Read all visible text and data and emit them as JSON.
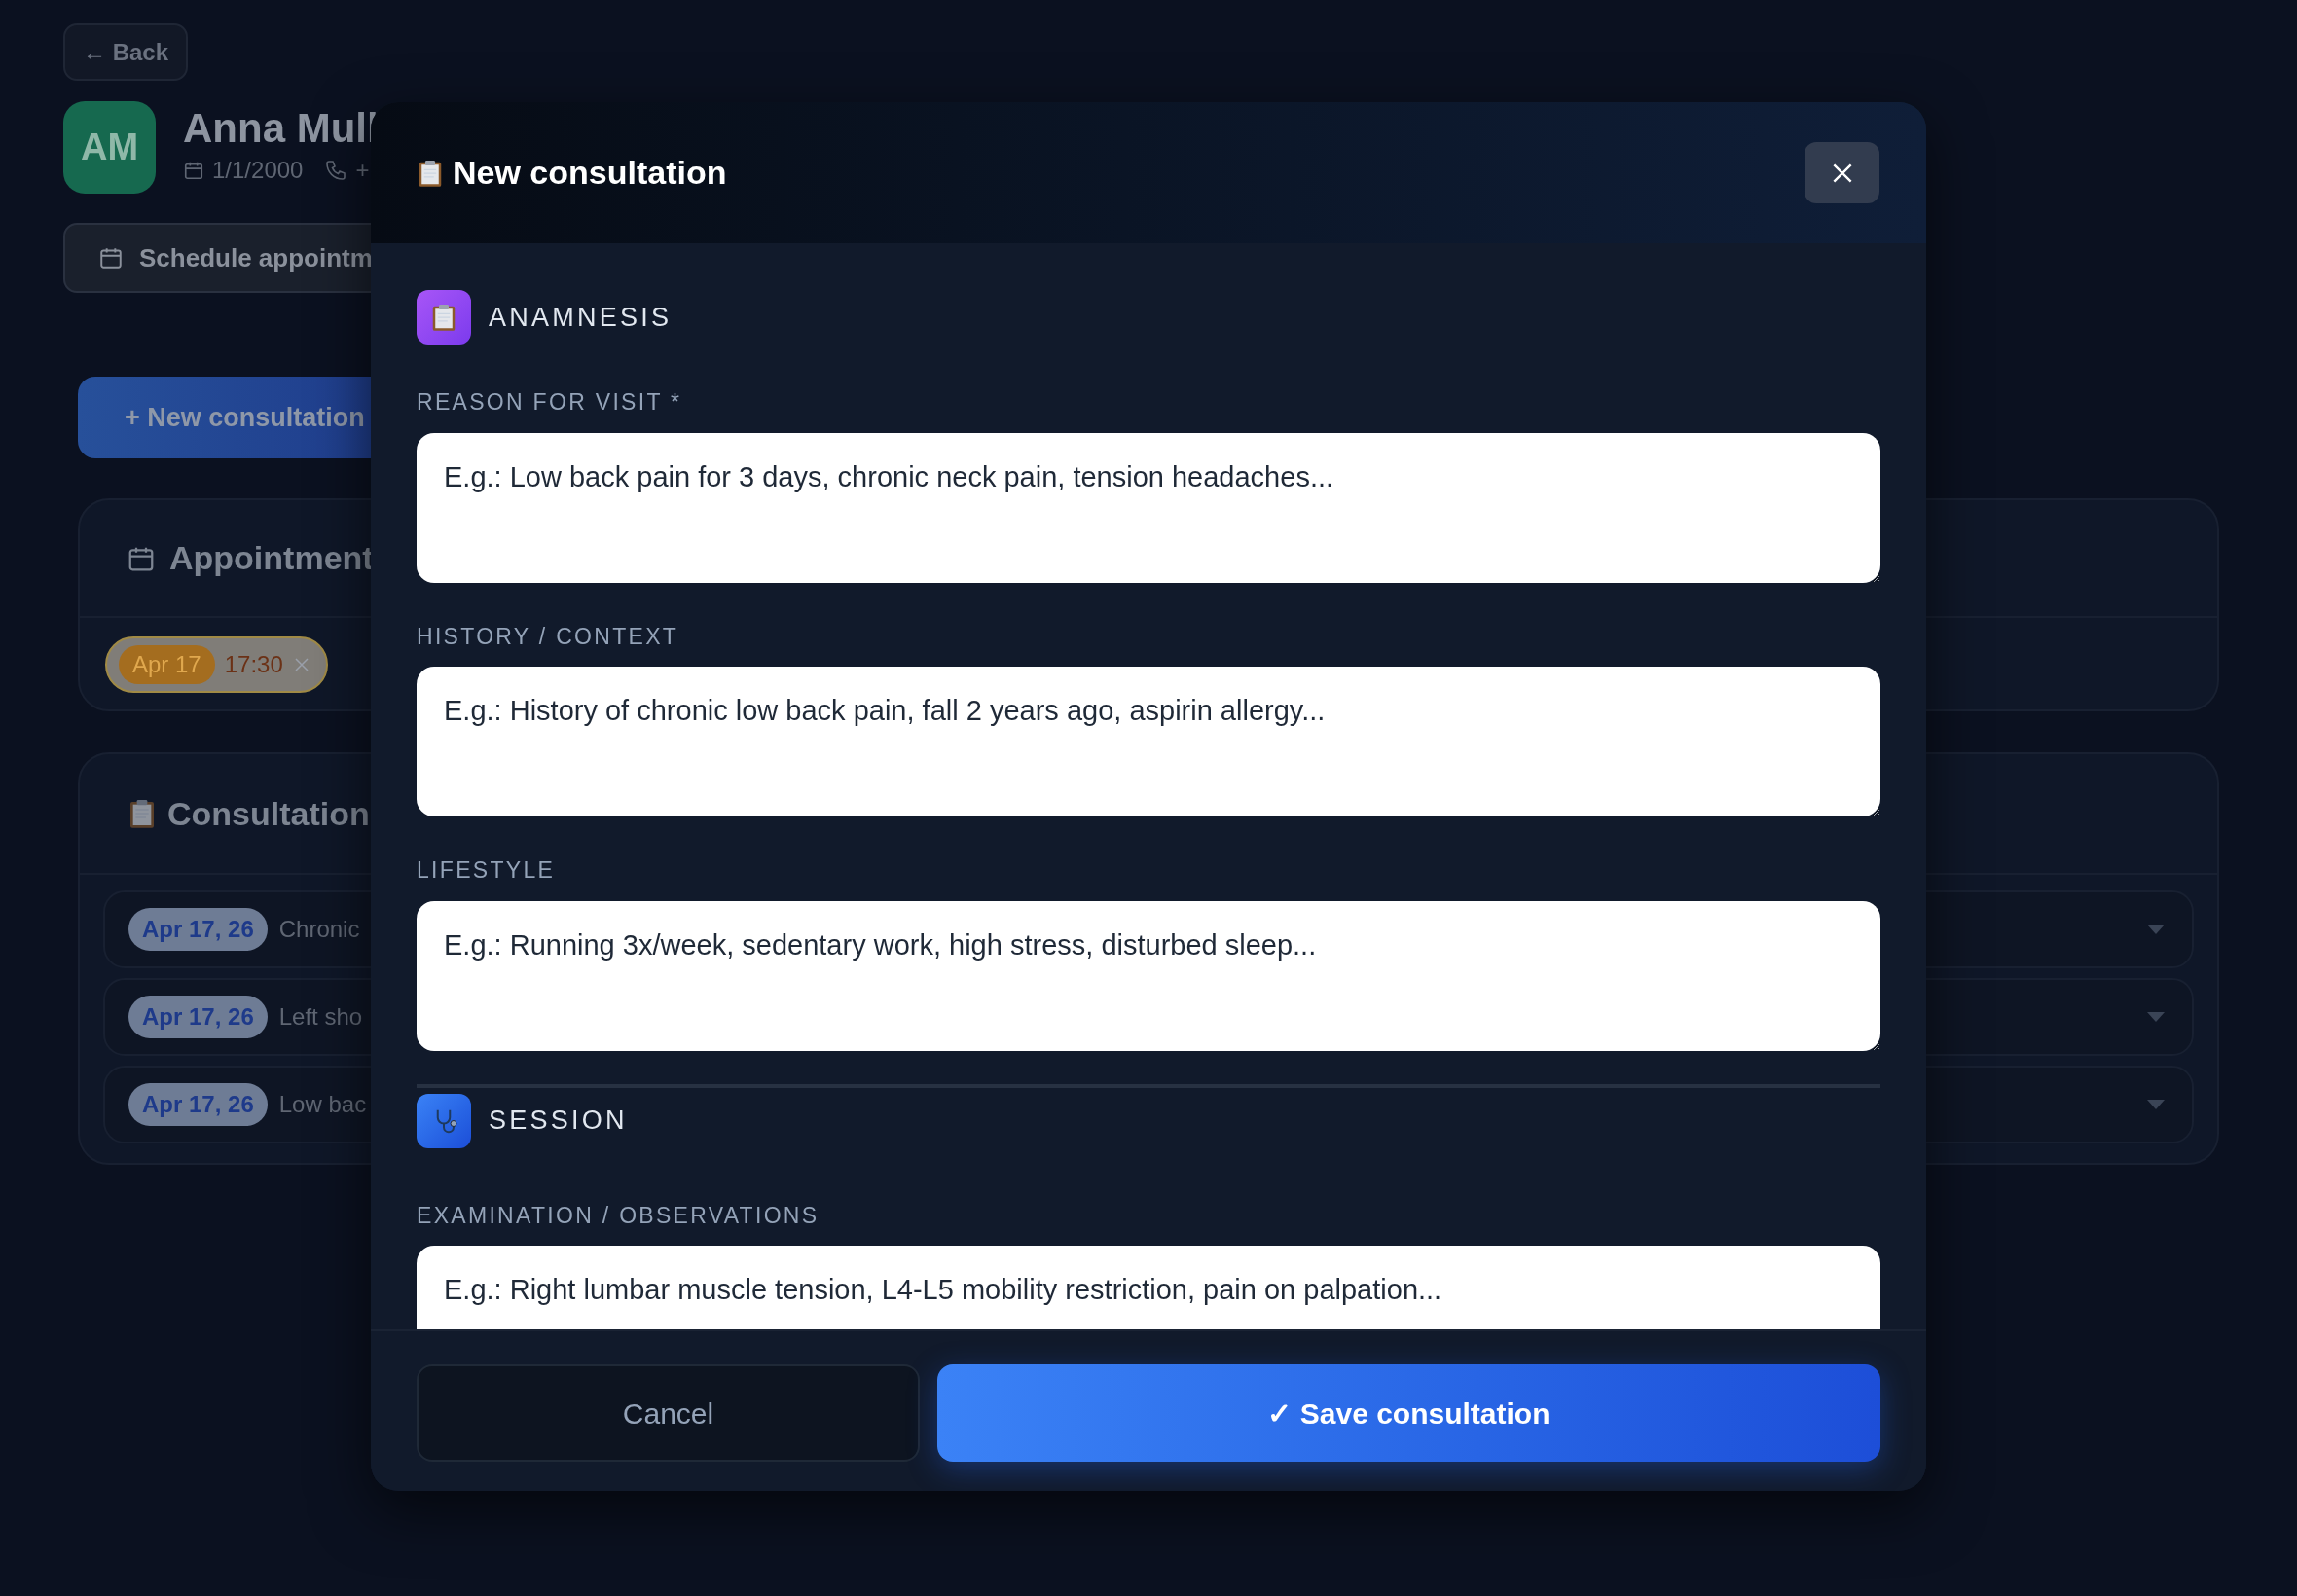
{
  "page": {
    "back_button": "← Back",
    "avatar_initials": "AM",
    "patient_name": "Anna Mull",
    "birth_date": "1/1/2000",
    "phone": "+",
    "schedule_button": "Schedule appointm",
    "new_consultation_button": "+ New consultation"
  },
  "appointments_card": {
    "title": "Appointment",
    "appointments": [
      {
        "date": "Apr 17",
        "time": "17:30"
      }
    ]
  },
  "consultations_card": {
    "title": "Consultation",
    "consultations": [
      {
        "date": "Apr 17, 26",
        "summary": "Chronic"
      },
      {
        "date": "Apr 17, 26",
        "summary": "Left sho"
      },
      {
        "date": "Apr 17, 26",
        "summary": "Low bac"
      }
    ]
  },
  "modal": {
    "title": "New consultation",
    "sections": [
      {
        "kind": "anamnesis",
        "title": "ANAMNESIS",
        "fields": [
          {
            "label": "REASON FOR VISIT *",
            "placeholder": "E.g.: Low back pain for 3 days, chronic neck pain, tension headaches..."
          },
          {
            "label": "HISTORY / CONTEXT",
            "placeholder": "E.g.: History of chronic low back pain, fall 2 years ago, aspirin allergy..."
          },
          {
            "label": "LIFESTYLE",
            "placeholder": "E.g.: Running 3x/week, sedentary work, high stress, disturbed sleep..."
          }
        ]
      },
      {
        "kind": "session",
        "title": "SESSION",
        "fields": [
          {
            "label": "EXAMINATION / OBSERVATIONS",
            "placeholder": "E.g.: Right lumbar muscle tension, L4-L5 mobility restriction, pain on palpation..."
          }
        ]
      }
    ],
    "cancel_button": "Cancel",
    "save_button": "✓ Save consultation"
  }
}
